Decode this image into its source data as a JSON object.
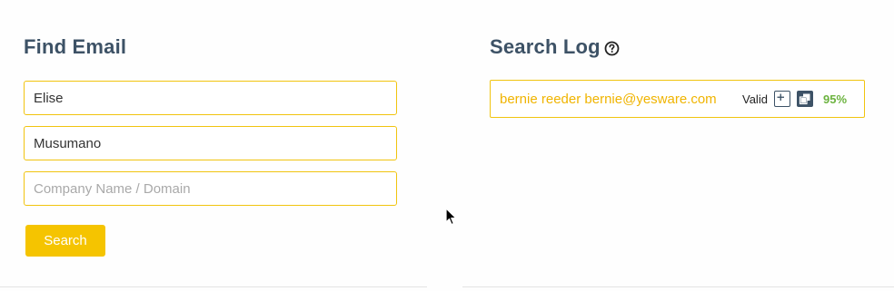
{
  "find_email": {
    "title": "Find Email",
    "first_name_value": "Elise",
    "last_name_value": "Musumano",
    "company_placeholder": "Company Name / Domain",
    "search_label": "Search"
  },
  "search_log": {
    "title": "Search Log",
    "help_icon": "question-circle-icon",
    "entries": [
      {
        "text": "bernie reeder bernie@yesware.com",
        "status": "Valid",
        "score": "95%",
        "actions": [
          "plus-square-icon",
          "copy-icon"
        ]
      }
    ]
  },
  "colors": {
    "accent": "#f5c400",
    "border": "#f1c40f",
    "heading": "#3d5266",
    "score": "#6cb33f",
    "log_text": "#f0b400"
  }
}
